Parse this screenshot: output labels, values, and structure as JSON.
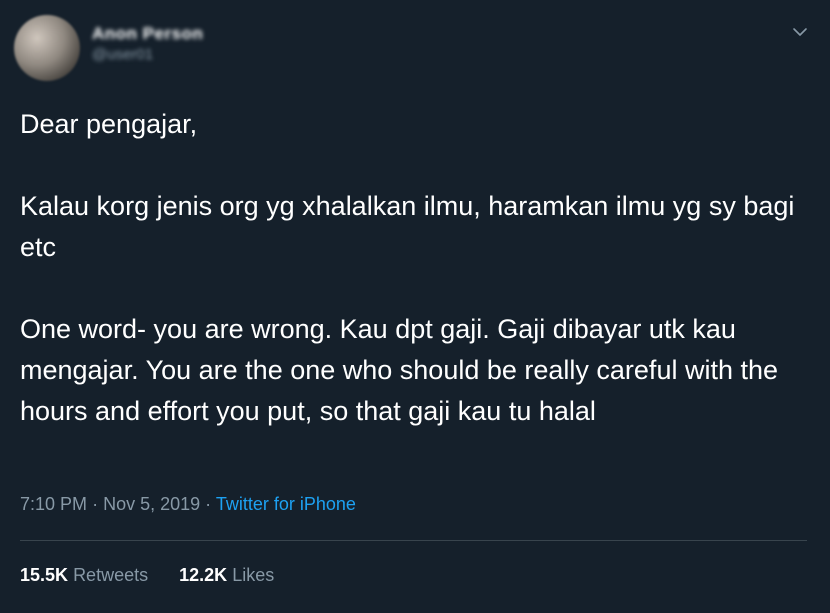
{
  "author": {
    "display_name": "Anon Person",
    "handle": "@user01"
  },
  "tweet": {
    "paragraphs": [
      "Dear pengajar,",
      "Kalau korg jenis org yg xhalalkan ilmu, haramkan ilmu yg sy bagi etc",
      "One word- you are wrong. Kau dpt gaji. Gaji dibayar utk kau mengajar. You are the one who should be really careful with the hours and effort you put, so that gaji kau tu halal"
    ],
    "time": "7:10 PM",
    "separator": "·",
    "date": "Nov 5, 2019",
    "source": "Twitter for iPhone"
  },
  "stats": {
    "retweets_count": "15.5K",
    "retweets_label": "Retweets",
    "likes_count": "12.2K",
    "likes_label": "Likes"
  },
  "icons": {
    "menu": "chevron-down-icon",
    "avatar": "profile-avatar"
  },
  "colors": {
    "background": "#15202b",
    "text": "#ffffff",
    "secondary_text": "#8899a6",
    "link": "#1da1f2",
    "divider": "#38444d"
  }
}
